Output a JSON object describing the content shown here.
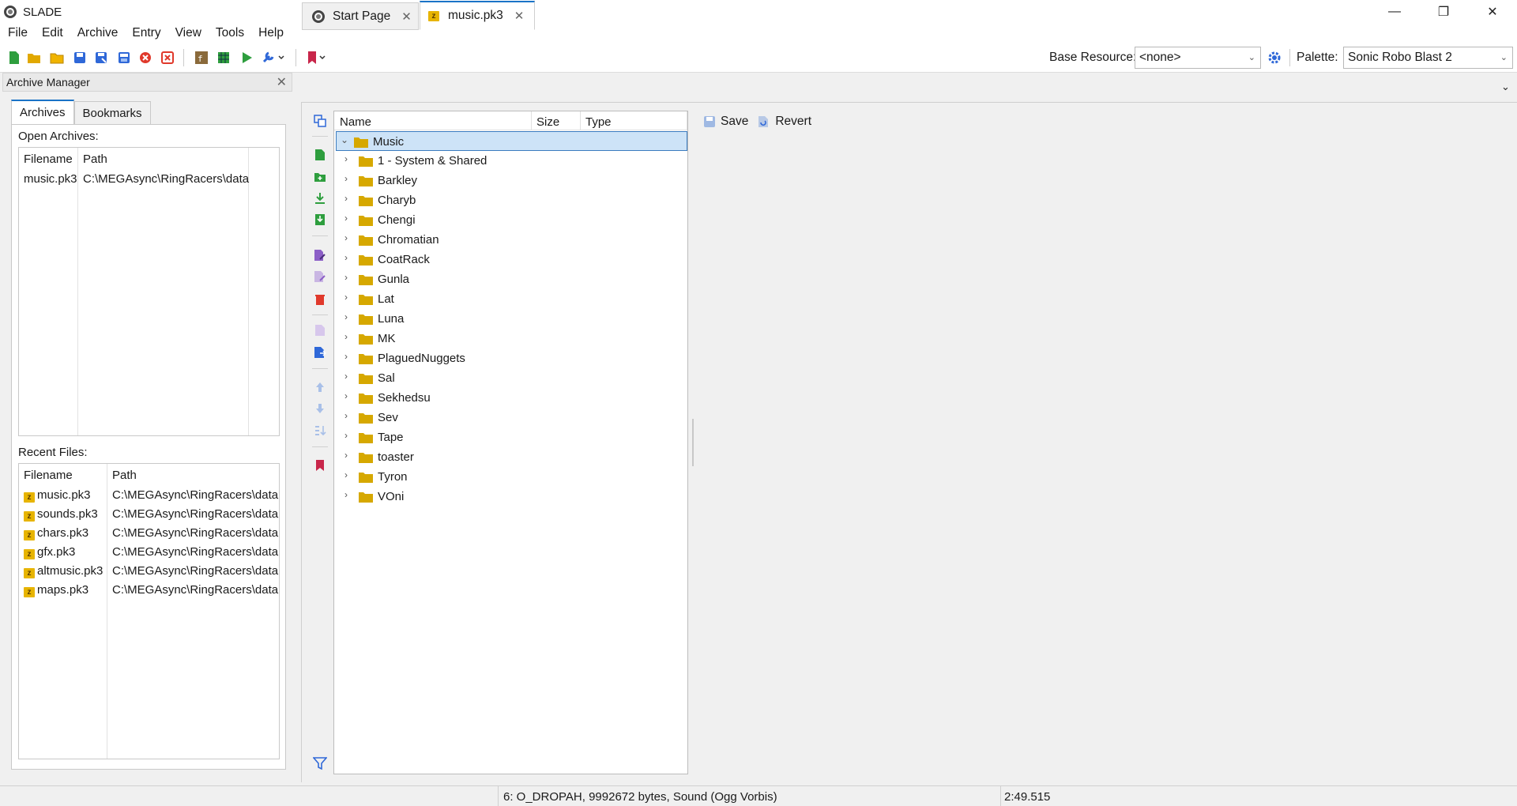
{
  "window": {
    "title": "SLADE"
  },
  "menu": [
    "File",
    "Edit",
    "Archive",
    "Entry",
    "View",
    "Tools",
    "Help"
  ],
  "toolbar": {
    "base_resource_label": "Base Resource:",
    "base_resource_value": "<none>",
    "palette_label": "Palette:",
    "palette_value": "Sonic Robo Blast 2"
  },
  "archive_manager": {
    "title": "Archive Manager",
    "tabs": [
      "Archives",
      "Bookmarks"
    ],
    "open_archives_label": "Open Archives:",
    "columns": [
      "Filename",
      "Path"
    ],
    "open_archives": [
      {
        "filename": "music.pk3",
        "path": "C:\\MEGAsync\\RingRacers\\data"
      }
    ],
    "recent_files_label": "Recent Files:",
    "recent_files": [
      {
        "filename": "music.pk3",
        "path": "C:\\MEGAsync\\RingRacers\\data"
      },
      {
        "filename": "sounds.pk3",
        "path": "C:\\MEGAsync\\RingRacers\\data"
      },
      {
        "filename": "chars.pk3",
        "path": "C:\\MEGAsync\\RingRacers\\data"
      },
      {
        "filename": "gfx.pk3",
        "path": "C:\\MEGAsync\\RingRacers\\data"
      },
      {
        "filename": "altmusic.pk3",
        "path": "C:\\MEGAsync\\RingRacers\\data"
      },
      {
        "filename": "maps.pk3",
        "path": "C:\\MEGAsync\\RingRacers\\data"
      }
    ]
  },
  "tabs": [
    {
      "label": "Start Page"
    },
    {
      "label": "music.pk3"
    }
  ],
  "entry_tree": {
    "columns": [
      "Name",
      "Size",
      "Type"
    ],
    "root": "Music",
    "folders": [
      "1 - System & Shared",
      "Barkley",
      "Charyb",
      "Chengi",
      "Chromatian",
      "CoatRack",
      "Gunla",
      "Lat",
      "Luna",
      "MK",
      "PlaguedNuggets",
      "Sal",
      "Sekhedsu",
      "Sev",
      "Tape",
      "toaster",
      "Tyron",
      "VOni"
    ]
  },
  "entry_actions": {
    "save": "Save",
    "revert": "Revert"
  },
  "status": {
    "entry_info": "6: O_DROPAH, 9992672 bytes, Sound (Ogg Vorbis)",
    "time": "2:49.515"
  },
  "icons": {
    "folder_color": "#d6a800",
    "accent": "#1a73c7",
    "selection": "#cde3f7"
  }
}
